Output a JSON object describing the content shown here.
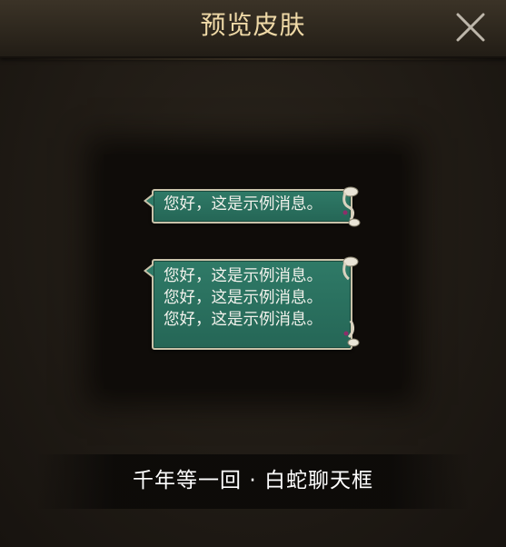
{
  "dialog": {
    "title": "预览皮肤",
    "close_icon": "close-x-icon"
  },
  "preview": {
    "bubbles": [
      {
        "lines": [
          "您好，这是示例消息。"
        ]
      },
      {
        "lines": [
          "您好，这是示例消息。",
          "您好，这是示例消息。",
          "您好，这是示例消息。"
        ]
      }
    ],
    "bubble_color": "#2f7a67",
    "bubble_border_color": "#c9c2a9",
    "decoration_icon": "white-snake-ornament-icon"
  },
  "skin": {
    "name": "千年等一回 · 白蛇聊天框"
  },
  "colors": {
    "title_text": "#efd9a7",
    "background": "#201b15"
  }
}
